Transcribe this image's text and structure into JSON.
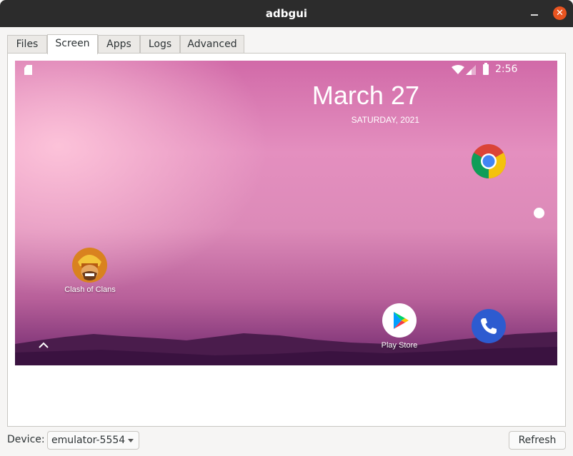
{
  "window": {
    "title": "adbgui"
  },
  "tabs": [
    {
      "label": "Files"
    },
    {
      "label": "Screen",
      "active": true
    },
    {
      "label": "Apps"
    },
    {
      "label": "Logs"
    },
    {
      "label": "Advanced"
    }
  ],
  "device_screen": {
    "status_bar": {
      "time": "2:56",
      "icons": [
        "sd-card-icon",
        "wifi-icon",
        "signal-icon",
        "battery-icon"
      ]
    },
    "clock": {
      "date": "March 27",
      "weekday_date": "SATURDAY, 2021"
    },
    "apps": [
      {
        "label": "Clash of Clans",
        "icon": "clash-of-clans-icon"
      },
      {
        "label": "",
        "icon": "chrome-icon"
      },
      {
        "label": "Play Store",
        "icon": "play-store-icon"
      },
      {
        "label": "",
        "icon": "phone-icon"
      }
    ],
    "colors": {
      "wallpaper_top": "#d16aa8",
      "wallpaper_bottom": "#6a2d66",
      "phone_blue": "#2d5bd0"
    }
  },
  "footer": {
    "device_label": "Device:",
    "device_value": "emulator-5554",
    "refresh_label": "Refresh"
  },
  "colors": {
    "titlebar": "#2c2c2c",
    "close_button": "#e95420",
    "window_bg": "#f6f5f4"
  }
}
